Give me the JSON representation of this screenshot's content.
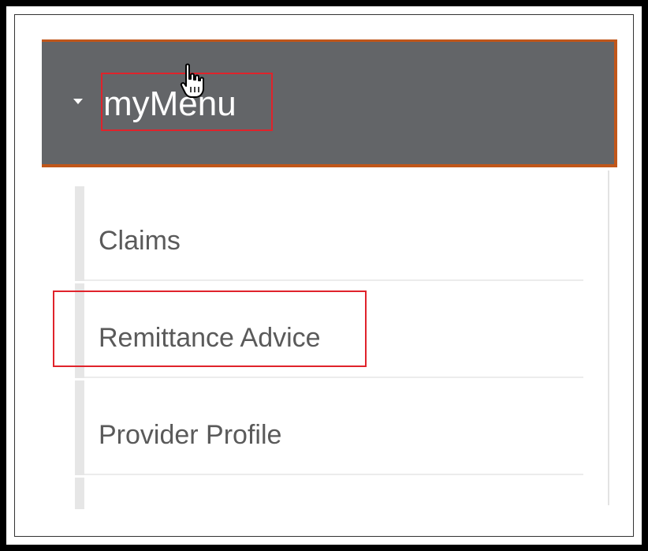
{
  "menu": {
    "title": "myMenu",
    "items": [
      {
        "label": "Claims"
      },
      {
        "label": "Remittance Advice"
      },
      {
        "label": "Provider Profile"
      }
    ]
  },
  "colors": {
    "header_bg": "#636568",
    "header_accent": "#c0561a",
    "highlight": "#e0232b",
    "item_text": "#5a5a5a"
  },
  "icons": {
    "caret": "caret-down-icon",
    "cursor": "hand-pointer-cursor-icon"
  }
}
